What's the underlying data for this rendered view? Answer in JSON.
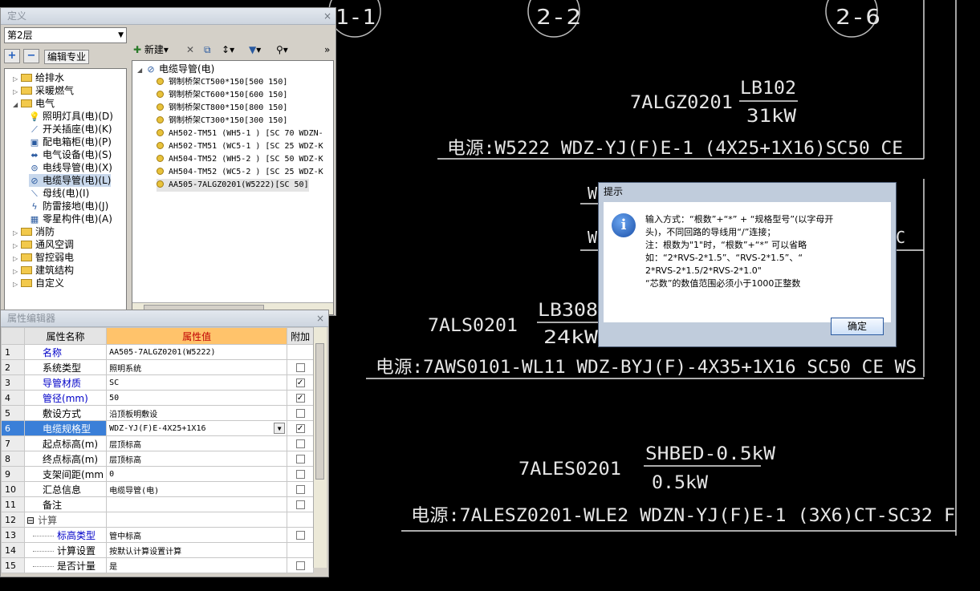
{
  "cad": {
    "circle_labels": [
      "1-1",
      "2-2",
      "2-6"
    ],
    "block1": {
      "id": "7ALGZ0201",
      "load_top": "LB102",
      "load_bottom": "31kW",
      "source": "电源:W5222 WDZ-YJ(F)E-1 (4X25+1X16)SC50 CE"
    },
    "partial_w1": "W",
    "partial_w2": "W",
    "partial_c": "C",
    "block2": {
      "id": "7ALS0201",
      "load_top": "LB308",
      "load_bottom": "24kW",
      "source": "电源:7AWS0101-WL11 WDZ-BYJ(F)-4X35+1X16 SC50 CE WS"
    },
    "block3": {
      "id": "7ALES0201",
      "load_top": "SHBED-0.5kW",
      "load_bottom": "0.5kW",
      "source": "电源:7ALESZ0201-WLE2 WDZN-YJ(F)E-1 (3X6)CT-SC32 F"
    }
  },
  "def_panel": {
    "title": "定义",
    "close": "×",
    "floor": "第2层",
    "add_icon": "+",
    "remove_icon": "−",
    "edit_profession": "编辑专业",
    "tree": [
      {
        "label": "给排水",
        "expander": "▷",
        "kind": "folder"
      },
      {
        "label": "采暖燃气",
        "expander": "▷",
        "kind": "folder"
      },
      {
        "label": "电气",
        "expander": "◢",
        "kind": "folder"
      },
      {
        "label": "照明灯具(电)(D)",
        "icon": "💡",
        "kind": "item"
      },
      {
        "label": "开关插座(电)(K)",
        "icon": "⟋",
        "kind": "item"
      },
      {
        "label": "配电箱柜(电)(P)",
        "icon": "▣",
        "kind": "item"
      },
      {
        "label": "电气设备(电)(S)",
        "icon": "⬌",
        "kind": "item"
      },
      {
        "label": "电线导管(电)(X)",
        "icon": "⊜",
        "kind": "item"
      },
      {
        "label": "电缆导管(电)(L)",
        "icon": "⊘",
        "kind": "item",
        "selected": true
      },
      {
        "label": "母线(电)(I)",
        "icon": "⟍",
        "kind": "item"
      },
      {
        "label": "防雷接地(电)(J)",
        "icon": "ϟ",
        "kind": "item"
      },
      {
        "label": "零星构件(电)(A)",
        "icon": "▦",
        "kind": "item"
      },
      {
        "label": "消防",
        "expander": "▷",
        "kind": "folder"
      },
      {
        "label": "通风空调",
        "expander": "▷",
        "kind": "folder"
      },
      {
        "label": "智控弱电",
        "expander": "▷",
        "kind": "folder"
      },
      {
        "label": "建筑结构",
        "expander": "▷",
        "kind": "folder"
      },
      {
        "label": "自定义",
        "expander": "▷",
        "kind": "folder"
      }
    ],
    "toolbar": {
      "new": "新建",
      "new_dd": "▾",
      "delete": "✕",
      "copy": "⧉",
      "sort": "↕",
      "sort_dd": "▾",
      "filter": "▼",
      "filter_dd": "▾",
      "find": "⚲",
      "find_dd": "▾",
      "more": "»"
    },
    "right_root": "电缆导管(电)",
    "right_items": [
      "钢制桥架CT500*150[500 150]",
      "钢制桥架CT600*150[600 150]",
      "钢制桥架CT800*150[800 150]",
      "钢制桥架CT300*150[300 150]",
      "AH502-TM51 (WH5-1 ) [SC 70  WDZN-",
      "AH502-TM51 (WC5-1 ) [SC 25  WDZ-K",
      "AH504-TM52 (WH5-2 ) [SC 50  WDZ-K",
      "AH504-TM52 (WC5-2 ) [SC 25  WDZ-K",
      "AA505-7ALGZ0201(W5222)[SC 50]"
    ]
  },
  "prop_panel": {
    "title": "属性编辑器",
    "close": "×",
    "headers": {
      "name": "属性名称",
      "value": "属性值",
      "extra": "附加"
    },
    "rows": [
      {
        "n": "1",
        "name": "名称",
        "value": "AA505-7ALGZ0201(W5222)",
        "blue": true,
        "check": "none"
      },
      {
        "n": "2",
        "name": "系统类型",
        "value": "照明系统",
        "check": "off"
      },
      {
        "n": "3",
        "name": "导管材质",
        "value": "SC",
        "blue": true,
        "check": "on"
      },
      {
        "n": "4",
        "name": "管径(mm)",
        "value": "50",
        "blue": true,
        "check": "on"
      },
      {
        "n": "5",
        "name": "敷设方式",
        "value": "沿顶板明敷设",
        "check": "off"
      },
      {
        "n": "6",
        "name": "电缆规格型",
        "value": "WDZ-YJ(F)E-4X25+1X16",
        "blue": true,
        "check": "on",
        "selected": true,
        "dropdown": true
      },
      {
        "n": "7",
        "name": "起点标高(m)",
        "value": "层顶标高",
        "check": "off"
      },
      {
        "n": "8",
        "name": "终点标高(m)",
        "value": "层顶标高",
        "check": "off"
      },
      {
        "n": "9",
        "name": "支架间距(mm",
        "value": "0",
        "check": "off"
      },
      {
        "n": "10",
        "name": "汇总信息",
        "value": "电缆导管(电)",
        "check": "off"
      },
      {
        "n": "11",
        "name": "备注",
        "value": "",
        "check": "off"
      },
      {
        "n": "12",
        "name": "计算",
        "value": "",
        "check": "none",
        "group": true,
        "expander": "⊟"
      },
      {
        "n": "13",
        "name": "标高类型",
        "value": "管中标高",
        "blue": true,
        "check": "off",
        "child": true
      },
      {
        "n": "14",
        "name": "计算设置",
        "value": "按默认计算设置计算",
        "check": "none",
        "child": true
      },
      {
        "n": "15",
        "name": "是否计量",
        "value": "是",
        "check": "off",
        "child": true
      }
    ]
  },
  "dialog": {
    "title": "提示",
    "icon": "i",
    "lines": [
      "输入方式：“根数”+“*”  +  “规格型号”(以字母开",
      "头)，不同回路的导线用“/”连接；",
      "注：根数为\"1\"时，“根数”+“*”  可以省略",
      "如：“2*RVS-2*1.5”、“RVS-2*1.5”、“",
      "2*RVS-2*1.5/2*RVS-2*1.0\"",
      "  “芯数”的数值范围必须小于1000正整数"
    ],
    "ok": "确定"
  },
  "colors": {
    "cad_bg": "#000000",
    "cad_line": "#e6e6e6",
    "header_value": "#ffc36b",
    "selected_row": "#3a7fd8"
  }
}
